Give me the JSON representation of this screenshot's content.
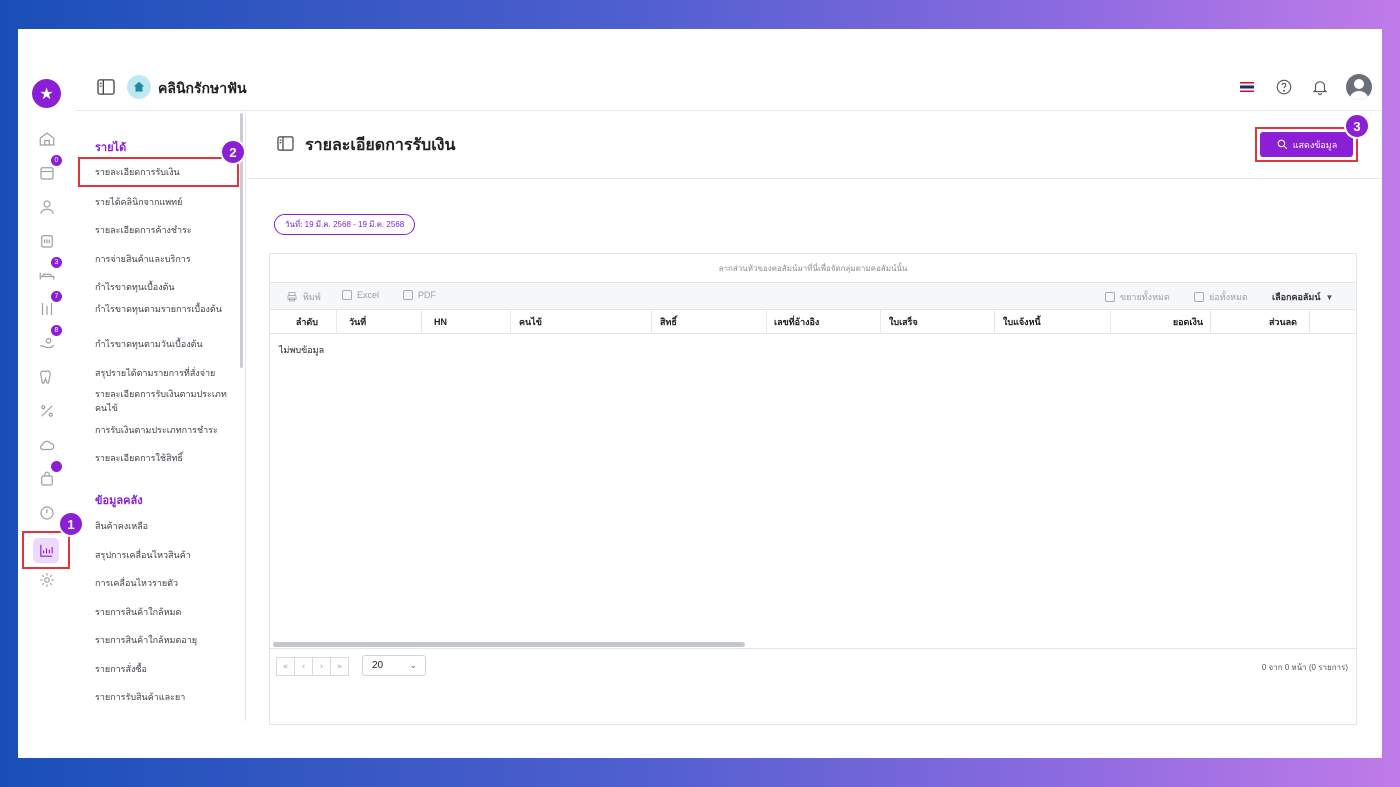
{
  "app": {
    "clinic_name": "คลินิกรักษาฟัน"
  },
  "rail": {
    "badges": {
      "appointments": "0",
      "queue": "3",
      "treatment": "7",
      "payment": "8"
    }
  },
  "submenu": {
    "section_income": "รายได้",
    "income_items": [
      "รายละเอียดการรับเงิน",
      "รายได้คลินิกจากแพทย์",
      "รายละเอียดการค้างชำระ",
      "การจ่ายสินค้าและบริการ",
      "กำไรขาดทุนเบื้องต้น",
      "กำไรขาดทุนตามรายการเบื้องต้น",
      "กำไรขาดทุนตามวันเบื้องต้น",
      "สรุปรายได้ตามรายการที่สั่งจ่าย",
      "รายละเอียดการรับเงินตามประเภทคนไข้",
      "การรับเงินตามประเภทการชำระ",
      "รายละเอียดการใช้สิทธิ์"
    ],
    "section_inventory": "ข้อมูลคลัง",
    "inventory_items": [
      "สินค้าคงเหลือ",
      "สรุปการเคลื่อนไหวสินค้า",
      "การเคลื่อนไหวรายตัว",
      "รายการสินค้าใกล้หมด",
      "รายการสินค้าใกล้หมดอายุ",
      "รายการสั่งซื้อ",
      "รายการรับสินค้าและยา"
    ]
  },
  "page": {
    "title": "รายละเอียดการรับเงิน",
    "show_button": "แสดงข้อมูล",
    "date_filter": "วันที่: 19 มี.ค. 2568 - 19 มี.ค. 2568"
  },
  "grid": {
    "group_panel_text": "ลากส่วนหัวของคอลัมน์มาที่นี่เพื่อจัดกลุ่มตามคอลัมน์นั้น",
    "toolbar": {
      "print": "พิมพ์",
      "excel": "Excel",
      "pdf": "PDF",
      "expand_all": "ขยายทั้งหมด",
      "collapse_all": "ย่อทั้งหมด",
      "column_chooser": "เลือกคอลัมน์"
    },
    "columns": [
      "ลำดับ",
      "วันที่",
      "HN",
      "คนไข้",
      "สิทธิ์",
      "เลขที่อ้างอิง",
      "ใบเสร็จ",
      "ใบแจ้งหนี้",
      "ยอดเงิน",
      "ส่วนลด"
    ],
    "no_data": "ไม่พบข้อมูล",
    "pager": {
      "page_size": "20",
      "info": "0 จาก 0 หน้า (0 รายการ)"
    }
  },
  "steps": [
    "1",
    "2",
    "3"
  ],
  "colors": {
    "accent": "#8a1fd6",
    "highlight": "#e2343b"
  }
}
